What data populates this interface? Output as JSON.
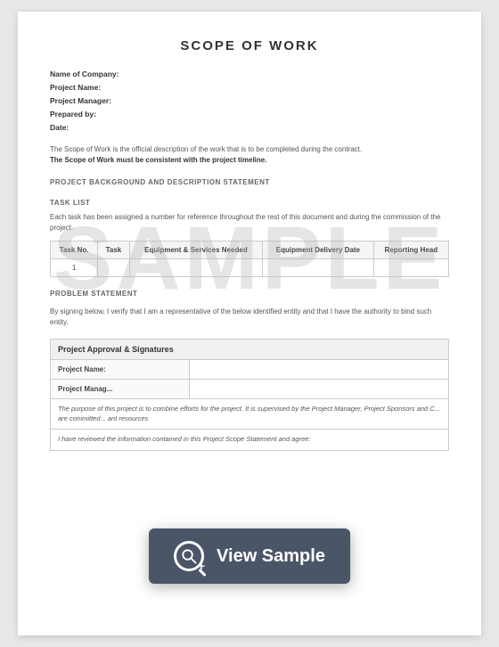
{
  "page": {
    "title": "SCOPE OF WORK",
    "watermark": "SAMPLE",
    "fields": {
      "company_label": "Name of Company:",
      "project_name_label": "Project Name:",
      "project_manager_label": "Project Manager:",
      "prepared_by_label": "Prepared by:",
      "date_label": "Date:"
    },
    "description": {
      "text": "The Scope of Work is the official description of the work that is to be completed during the contract.",
      "bold_text": "The Scope of Work must be consistent with the project timeline."
    },
    "sections": {
      "background_heading": "PROJECT BACKGROUND AND DESCRIPTION STATEMENT",
      "task_list_heading": "TASK LIST",
      "task_list_description": "Each task has been assigned a number for reference throughout the rest of this document and during the commission of the project.",
      "problem_statement_heading": "PROBLEM STATEMENT",
      "problem_statement_text": "By signing below, I verify that I am a representative of the below identified entity and that I have the authority to bind such entity."
    },
    "task_table": {
      "headers": [
        "Task No.",
        "Task",
        "Equipment & Services Needed",
        "Equipment Delivery Date",
        "Reporting Head"
      ],
      "rows": [
        [
          "1",
          "",
          "",
          "",
          ""
        ]
      ]
    },
    "approval_table": {
      "title": "Project Approval & Signatures",
      "rows": [
        {
          "label": "Project Name:",
          "value": ""
        },
        {
          "label": "Project Manager:",
          "value": ""
        },
        {
          "label": "purpose_italic",
          "value": "The purpose of this project is to combine efforts for the project. It is supervised by the Project Manager, Project Sponsors and C... are committed... ant resources"
        },
        {
          "label": "reviewed_italic",
          "value": "I have reviewed the information contained in this Project Scope Statement and agree:"
        }
      ]
    },
    "view_sample_button": {
      "label": "View Sample",
      "icon": "🔍"
    }
  }
}
